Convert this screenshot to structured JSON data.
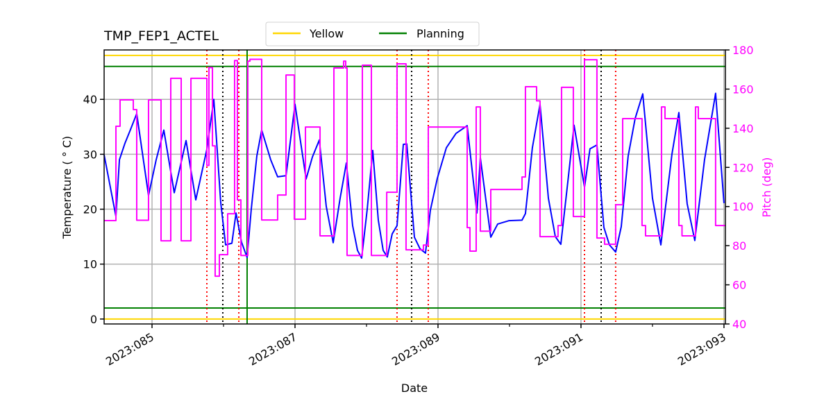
{
  "chart_data": {
    "type": "line",
    "title": "TMP_FEP1_ACTEL",
    "xlabel": "Date",
    "ylabel": "Temperature ($^\\circ$C)",
    "ylabel_display": "Temperature ( ° C)",
    "y2label": "Pitch (deg)",
    "x_units": "day of year 2023",
    "xlim": [
      84.33,
      93.02
    ],
    "ylim": [
      -0.9,
      49.0
    ],
    "y2lim": [
      40,
      180
    ],
    "grid": true,
    "x_ticks": [
      {
        "value": 85,
        "label": "2023:085"
      },
      {
        "value": 87,
        "label": "2023:087"
      },
      {
        "value": 89,
        "label": "2023:089"
      },
      {
        "value": 91,
        "label": "2023:091"
      },
      {
        "value": 93,
        "label": "2023:093"
      }
    ],
    "x_minor_ticks": [
      86,
      88,
      90,
      92
    ],
    "y_ticks": [
      0,
      10,
      20,
      30,
      40
    ],
    "y2_ticks": [
      40,
      60,
      80,
      100,
      120,
      140,
      160,
      180
    ],
    "legend": {
      "placement": "top-center-above",
      "entries": [
        {
          "label": "Yellow",
          "color": "#FFD700"
        },
        {
          "label": "Planning",
          "color": "#008000"
        }
      ]
    },
    "limits": [
      {
        "name": "yellow-hi",
        "value": 48,
        "color": "#FFD700"
      },
      {
        "name": "yellow-lo",
        "value": 0,
        "color": "#FFD700"
      },
      {
        "name": "planning-hi",
        "value": 46,
        "color": "#008000"
      },
      {
        "name": "planning-lo",
        "value": 2,
        "color": "#008000"
      }
    ],
    "vlines": [
      {
        "x": 85.767,
        "color": "#FF0000",
        "style": "dotted"
      },
      {
        "x": 85.99,
        "color": "#000000",
        "style": "dotted"
      },
      {
        "x": 86.214,
        "color": "#FF0000",
        "style": "dotted"
      },
      {
        "x": 86.33,
        "color": "#008000",
        "style": "solid"
      },
      {
        "x": 88.427,
        "color": "#FF0000",
        "style": "dotted"
      },
      {
        "x": 88.631,
        "color": "#000000",
        "style": "dotted"
      },
      {
        "x": 88.864,
        "color": "#FF0000",
        "style": "dotted"
      },
      {
        "x": 91.049,
        "color": "#FF0000",
        "style": "dotted"
      },
      {
        "x": 91.282,
        "color": "#000000",
        "style": "dotted"
      },
      {
        "x": 91.485,
        "color": "#FF0000",
        "style": "dotted"
      }
    ],
    "series": [
      {
        "name": "TMP_FEP1_ACTEL",
        "axis": "left",
        "color": "#0000FF",
        "points": [
          [
            84.33,
            29.9
          ],
          [
            84.495,
            18.7
          ],
          [
            84.544,
            29.0
          ],
          [
            84.621,
            32.0
          ],
          [
            84.699,
            34.5
          ],
          [
            84.786,
            37.4
          ],
          [
            84.951,
            22.5
          ],
          [
            85.058,
            29.0
          ],
          [
            85.165,
            34.4
          ],
          [
            85.311,
            23.0
          ],
          [
            85.476,
            32.5
          ],
          [
            85.612,
            21.7
          ],
          [
            85.767,
            30.9
          ],
          [
            85.864,
            40.0
          ],
          [
            85.961,
            21.2
          ],
          [
            86.029,
            13.5
          ],
          [
            86.117,
            13.8
          ],
          [
            86.175,
            19.3
          ],
          [
            86.252,
            14.0
          ],
          [
            86.33,
            11.2
          ],
          [
            86.388,
            20.0
          ],
          [
            86.466,
            29.7
          ],
          [
            86.534,
            34.4
          ],
          [
            86.66,
            29.0
          ],
          [
            86.757,
            25.9
          ],
          [
            86.874,
            26.1
          ],
          [
            87.0,
            39.1
          ],
          [
            87.155,
            25.5
          ],
          [
            87.243,
            29.5
          ],
          [
            87.34,
            32.6
          ],
          [
            87.437,
            20.5
          ],
          [
            87.534,
            13.9
          ],
          [
            87.631,
            22.0
          ],
          [
            87.718,
            28.4
          ],
          [
            87.806,
            17.0
          ],
          [
            87.874,
            12.5
          ],
          [
            87.932,
            11.1
          ],
          [
            88.01,
            20.0
          ],
          [
            88.087,
            30.7
          ],
          [
            88.165,
            18.0
          ],
          [
            88.233,
            12.5
          ],
          [
            88.291,
            11.3
          ],
          [
            88.359,
            15.5
          ],
          [
            88.427,
            17.0
          ],
          [
            88.515,
            31.8
          ],
          [
            88.563,
            31.9
          ],
          [
            88.67,
            14.9
          ],
          [
            88.748,
            12.8
          ],
          [
            88.825,
            12.0
          ],
          [
            88.893,
            19.8
          ],
          [
            88.99,
            25.6
          ],
          [
            89.117,
            31.2
          ],
          [
            89.252,
            33.8
          ],
          [
            89.408,
            35.2
          ],
          [
            89.544,
            19.3
          ],
          [
            89.592,
            29.4
          ],
          [
            89.738,
            14.9
          ],
          [
            89.835,
            17.3
          ],
          [
            89.99,
            17.9
          ],
          [
            90.175,
            18.0
          ],
          [
            90.223,
            19.2
          ],
          [
            90.32,
            31.2
          ],
          [
            90.427,
            39.1
          ],
          [
            90.544,
            22.0
          ],
          [
            90.641,
            15.0
          ],
          [
            90.718,
            13.6
          ],
          [
            90.816,
            25.0
          ],
          [
            90.903,
            35.3
          ],
          [
            91.049,
            24.0
          ],
          [
            91.126,
            31.0
          ],
          [
            91.223,
            31.7
          ],
          [
            91.32,
            16.7
          ],
          [
            91.398,
            13.5
          ],
          [
            91.485,
            12.2
          ],
          [
            91.563,
            16.8
          ],
          [
            91.66,
            29.7
          ],
          [
            91.757,
            36.5
          ],
          [
            91.864,
            41.0
          ],
          [
            92.0,
            22.0
          ],
          [
            92.117,
            13.5
          ],
          [
            92.175,
            19.6
          ],
          [
            92.272,
            30.0
          ],
          [
            92.369,
            37.6
          ],
          [
            92.485,
            21.0
          ],
          [
            92.592,
            14.3
          ],
          [
            92.728,
            29.0
          ],
          [
            92.883,
            41.1
          ],
          [
            93.0,
            21.1
          ]
        ]
      },
      {
        "name": "Pitch",
        "axis": "right",
        "color": "#FF00FF",
        "step": true,
        "points": [
          [
            84.33,
            92.8
          ],
          [
            84.495,
            141.0
          ],
          [
            84.553,
            154.5
          ],
          [
            84.738,
            149.5
          ],
          [
            84.786,
            93.0
          ],
          [
            84.951,
            154.5
          ],
          [
            85.126,
            82.5
          ],
          [
            85.262,
            165.5
          ],
          [
            85.408,
            82.5
          ],
          [
            85.544,
            165.5
          ],
          [
            85.767,
            121.0
          ],
          [
            85.796,
            171.0
          ],
          [
            85.845,
            131.0
          ],
          [
            85.883,
            64.4
          ],
          [
            85.942,
            75.4
          ],
          [
            86.058,
            96.3
          ],
          [
            86.155,
            174.6
          ],
          [
            86.194,
            103.4
          ],
          [
            86.243,
            75.0
          ],
          [
            86.34,
            174.3
          ],
          [
            86.37,
            175.2
          ],
          [
            86.534,
            93.1
          ],
          [
            86.757,
            105.9
          ],
          [
            86.874,
            167.2
          ],
          [
            86.99,
            93.5
          ],
          [
            87.146,
            140.6
          ],
          [
            87.35,
            85.0
          ],
          [
            87.544,
            170.8
          ],
          [
            87.68,
            174.3
          ],
          [
            87.709,
            170.8
          ],
          [
            87.728,
            75.0
          ],
          [
            87.942,
            172.2
          ],
          [
            88.068,
            75.0
          ],
          [
            88.283,
            107.3
          ],
          [
            88.427,
            172.9
          ],
          [
            88.553,
            77.9
          ],
          [
            88.796,
            80.3
          ],
          [
            88.864,
            140.6
          ],
          [
            89.408,
            89.2
          ],
          [
            89.447,
            77.2
          ],
          [
            89.534,
            150.9
          ],
          [
            89.592,
            87.4
          ],
          [
            89.738,
            108.7
          ],
          [
            90.175,
            115.1
          ],
          [
            90.223,
            161.2
          ],
          [
            90.379,
            154.0
          ],
          [
            90.427,
            84.6
          ],
          [
            90.679,
            90.3
          ],
          [
            90.728,
            160.9
          ],
          [
            90.893,
            94.9
          ],
          [
            91.049,
            175.0
          ],
          [
            91.223,
            83.9
          ],
          [
            91.33,
            80.7
          ],
          [
            91.485,
            100.9
          ],
          [
            91.583,
            144.9
          ],
          [
            91.854,
            90.3
          ],
          [
            91.903,
            85.0
          ],
          [
            92.126,
            150.9
          ],
          [
            92.175,
            144.9
          ],
          [
            92.369,
            90.3
          ],
          [
            92.413,
            85.0
          ],
          [
            92.602,
            150.9
          ],
          [
            92.641,
            144.9
          ],
          [
            92.883,
            90.3
          ],
          [
            93.02,
            90.3
          ]
        ]
      }
    ]
  }
}
